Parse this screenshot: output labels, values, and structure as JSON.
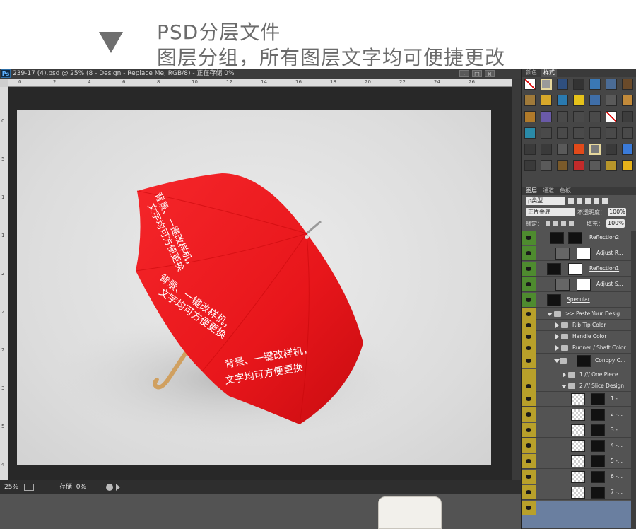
{
  "header": {
    "line1": "PSD分层文件",
    "line2": "图层分组，所有图层文字均可便捷更改"
  },
  "window": {
    "app_icon": "Ps",
    "title": "239-17 (4).psd @ 25% (8 - Design - Replace Me, RGB/8) - 正在存储 0%",
    "buttons": [
      "-",
      "□",
      "×"
    ]
  },
  "ruler_top": [
    "0",
    "2",
    "4",
    "6",
    "8",
    "10",
    "12",
    "14",
    "16",
    "18",
    "20",
    "22",
    "24",
    "26"
  ],
  "ruler_left": [
    "0",
    "5",
    "1",
    "1",
    "2",
    "2",
    "2",
    "3",
    "5",
    "4"
  ],
  "canvas": {
    "umbrella_text_1": "背景、一键改样机，",
    "umbrella_text_2": "文字均可方便更换"
  },
  "status": {
    "zoom": "25%",
    "label": "存储",
    "progress": "0%"
  },
  "right_panel": {
    "top_tabs": [
      "颜色",
      "样式"
    ],
    "layer_tabs": [
      "图层",
      "通道",
      "色板"
    ],
    "kind": "ρ类型",
    "filter_icons": [
      "image-icon",
      "adjust-icon",
      "T",
      "shape-icon",
      "smart-icon"
    ],
    "blend": "正片叠底",
    "opacity_label": "不透明度：",
    "opacity": "100%",
    "lock_label": "锁定：",
    "fill_label": "填充：",
    "fill": "100%",
    "layers": [
      {
        "name": "Reflection2"
      },
      {
        "name": "Adjust R..."
      },
      {
        "name": "Reflection1"
      },
      {
        "name": "Adjust S..."
      },
      {
        "name": "Specular"
      },
      {
        "name": ">> Paste Your Desig..."
      },
      {
        "name": "Rib Tip Color"
      },
      {
        "name": "Handle Color"
      },
      {
        "name": "Runner / Shaft Color"
      },
      {
        "name": "Conopy C..."
      },
      {
        "name": "1 /// One Piece..."
      },
      {
        "name": "2 /// Slice Design"
      },
      {
        "name": "1 -..."
      },
      {
        "name": "2 -..."
      },
      {
        "name": "3 -..."
      },
      {
        "name": "4 -..."
      },
      {
        "name": "5 -..."
      },
      {
        "name": "6 -..."
      },
      {
        "name": "7 -..."
      }
    ]
  },
  "colors": {
    "umbrella_red": "#e8161b",
    "eye_green": "#4e8b2f",
    "eye_gold": "#b8a02a"
  }
}
